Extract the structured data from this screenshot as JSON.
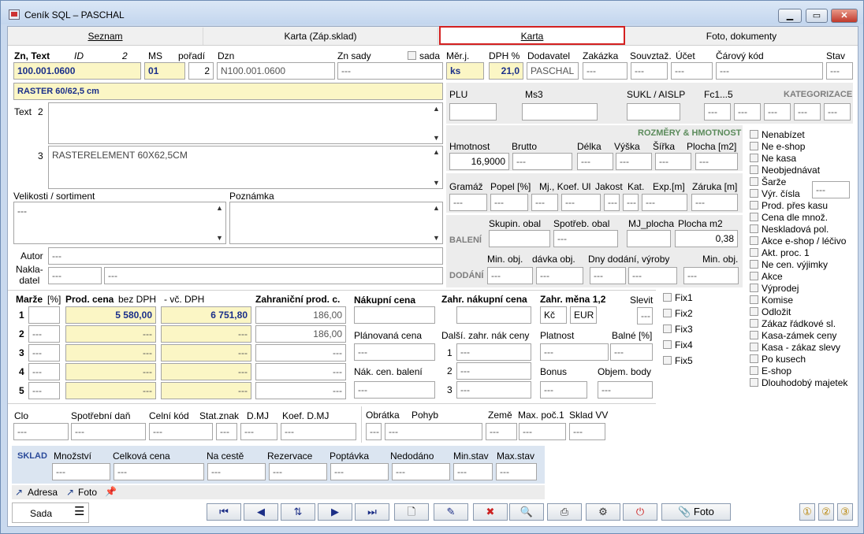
{
  "window": {
    "title": "Ceník SQL – PASCHAL",
    "btn_min": "▁",
    "btn_max": "▭",
    "btn_close": "✕"
  },
  "tabs": [
    "Seznam",
    "Karta (Záp.sklad)",
    "Karta",
    "Foto, dokumenty"
  ],
  "header": {
    "zn_text_label": "Zn, Text",
    "id_label": "ID",
    "id_value": "2",
    "ms_label": "MS",
    "poradi_label": "pořadí",
    "dzn_label": "Dzn",
    "zn_sady_label": "Zn sady",
    "sada_label": "sada",
    "merj_label": "Měr.j.",
    "dph_label": "DPH %",
    "dodavatel_label": "Dodavatel",
    "zakazka_label": "Zakázka",
    "souvztaz_label": "Souvztaž.",
    "ucet_label": "Účet",
    "carovy_kod_label": "Čárový kód",
    "stav_label": "Stav",
    "zn_value": "100.001.0600",
    "ms_value": "01",
    "poradi_value": "2",
    "dzn_value": "N100.001.0600",
    "zn_sady_value": "---",
    "merj_value": "ks",
    "dph_value": "21,0",
    "dodavatel_value": "PASCHAL",
    "zakazka_value": "---",
    "souvztaz_value": "---",
    "ucet_value": "---",
    "carovy_value": "---",
    "stav_value": "---",
    "name": "RASTER  60/62,5 cm"
  },
  "texts": {
    "text_label": "Text",
    "text_2": "2",
    "text_3": "3",
    "text3_value": "RASTERELEMENT 60X62,5CM",
    "velikosti_label": "Velikosti / sortiment",
    "velikosti_value": "---",
    "poznamka_label": "Poznámka",
    "autor_label": "Autor",
    "autor_value": "---",
    "nakladatel_label": "Nakla-\ndatel",
    "nakladatel_v1": "---",
    "nakladatel_v2": "---"
  },
  "plu": {
    "plu_label": "PLU",
    "ms3_label": "Ms3",
    "sukl_label": "SUKL / AISLP",
    "fc_label": "Fc1...5",
    "kategorizace": "KATEGORIZACE",
    "f1": "---",
    "f2": "---",
    "f3": "---",
    "f4": "---",
    "f5": "---"
  },
  "rozmery": {
    "title": "ROZMĚRY & HMOTNOST",
    "hmotnost_label": "Hmotnost",
    "brutto_label": "Brutto",
    "delka_label": "Délka",
    "vyska_label": "Výška",
    "sirka_label": "Šířka",
    "plocha_label": "Plocha [m2]",
    "hmotnost": "16,9000",
    "brutto": "---",
    "delka": "---",
    "vyska": "---",
    "sirka": "---",
    "plocha": "---",
    "gramaz_label": "Gramáž",
    "popel_label": "Popel [%]",
    "mj_koef_label": "Mj., Koef. Ul",
    "jakost_label": "Jakost",
    "kat_label": "Kat.",
    "exp_label": "Exp.[m]",
    "zaruka_label": "Záruka [m]",
    "gramaz": "---",
    "popel": "---",
    "mj": "---",
    "koef": "---",
    "jakost": "---",
    "kat": "---",
    "exp": "---",
    "zaruka": "---"
  },
  "baleni": {
    "baleni_label": "BALENÍ",
    "skupin_label": "Skupin. obal",
    "spotreb_label": "Spotřeb. obal",
    "mj_plocha_label": "MJ_plocha",
    "plocha_m2_label": "Plocha m2",
    "skupin": "",
    "spotreb": "---",
    "mj_plocha": "",
    "plocha_m2": "0,38",
    "dodani_label": "DODÁNÍ",
    "min_obj_label": "Min. obj.",
    "davka_label": "dávka obj.",
    "dny_label": "Dny dodání, výroby",
    "min_obj2_label": "Min. obj.",
    "min_obj": "---",
    "davka": "---",
    "dny1": "---",
    "dny2": "---",
    "min_obj2": "---"
  },
  "flags": [
    "Nenabízet",
    "Ne e-shop",
    "Ne kasa",
    "Neobjednávat",
    "Šarže",
    "Výr. čísla",
    "Prod. přes kasu",
    "Cena dle množ.",
    "Neskladová pol.",
    "Akce e-shop / léčivo",
    "Akt. proc. 1",
    "Ne cen. výjimky",
    "Akce",
    "Výprodej",
    "Komise",
    "Odložit",
    "Zákaz řádkové sl.",
    "Kasa-zámek ceny",
    "Kasa - zákaz slevy",
    "Po kusech",
    "E-shop",
    "Dlouhodobý majetek"
  ],
  "vyr_cisla_value": "---",
  "prices": {
    "marze_label": "Marže",
    "pct_label": "[%]",
    "prod_label": "Prod. cena",
    "bez_dph_label": "bez DPH",
    "vc_dph_label": "- vč. DPH",
    "zahr_label": "Zahraniční prod. c.",
    "rows": [
      {
        "n": "1",
        "marze": "",
        "bez": "5 580,00",
        "vc": "6 751,80",
        "zahr": "186,00"
      },
      {
        "n": "2",
        "marze": "---",
        "bez": "---",
        "vc": "---",
        "zahr": "186,00"
      },
      {
        "n": "3",
        "marze": "---",
        "bez": "---",
        "vc": "---",
        "zahr": "---"
      },
      {
        "n": "4",
        "marze": "---",
        "bez": "---",
        "vc": "---",
        "zahr": "---"
      },
      {
        "n": "5",
        "marze": "---",
        "bez": "---",
        "vc": "---",
        "zahr": "---"
      }
    ]
  },
  "nakup": {
    "nakupni_label": "Nákupní cena",
    "zahr_nakupni_label": "Zahr. nákupní cena",
    "zahr_mena_label": "Zahr. měna 1,2",
    "slevit_label": "Slevit",
    "mena1": "Kč",
    "mena2": "EUR",
    "slevit": "---",
    "planovana_label": "Plánovaná cena",
    "dalsi_label": "Další. zahr. nák ceny",
    "platnost_label": "Platnost",
    "balne_label": "Balné [%]",
    "planovana": "---",
    "d1": "---",
    "d2": "---",
    "d3": "---",
    "platnost": "---",
    "balne": "---",
    "nak_baleni_label": "Nák. cen. balení",
    "nak_baleni": "---",
    "bonus_label": "Bonus",
    "objem_label": "Objem. body",
    "bonus": "---",
    "objem": "---"
  },
  "fix": [
    "Fix1",
    "Fix2",
    "Fix3",
    "Fix4",
    "Fix5"
  ],
  "clo": {
    "clo_label": "Clo",
    "spotreb_dan_label": "Spotřební daň",
    "celni_label": "Celní kód",
    "stat_label": "Stat.znak",
    "dmj_label": "D.MJ",
    "koef_dmj_label": "Koef. D.MJ",
    "clo": "---",
    "spotreb_dan": "---",
    "celni": "---",
    "stat": "---",
    "dmj": "---",
    "koef_dmj": "---",
    "obratka_label": "Obrátka",
    "pohyb_label": "Pohyb",
    "zeme_label": "Země",
    "max_poc_label": "Max. poč.1",
    "sklad_vv_label": "Sklad VV",
    "obratka": "---",
    "pohyb": "---",
    "zeme": "---",
    "max_poc": "---",
    "sklad_vv": "---"
  },
  "sklad": {
    "title": "SKLAD",
    "mnozstvi_label": "Množství",
    "celkova_label": "Celková cena",
    "na_ceste_label": "Na cestě",
    "rezervace_label": "Rezervace",
    "poptavka_label": "Poptávka",
    "nedodano_label": "Nedodáno",
    "min_stav_label": "Min.stav",
    "max_stav_label": "Max.stav",
    "mnozstvi": "---",
    "celkova": "---",
    "na_ceste": "---",
    "rezervace": "---",
    "poptavka": "---",
    "nedodano": "---",
    "min_stav": "---",
    "max_stav": "---"
  },
  "links": {
    "adresa": "Adresa",
    "foto": "Foto"
  },
  "toolbar": {
    "sada": "Sada",
    "foto": "Fotо"
  }
}
